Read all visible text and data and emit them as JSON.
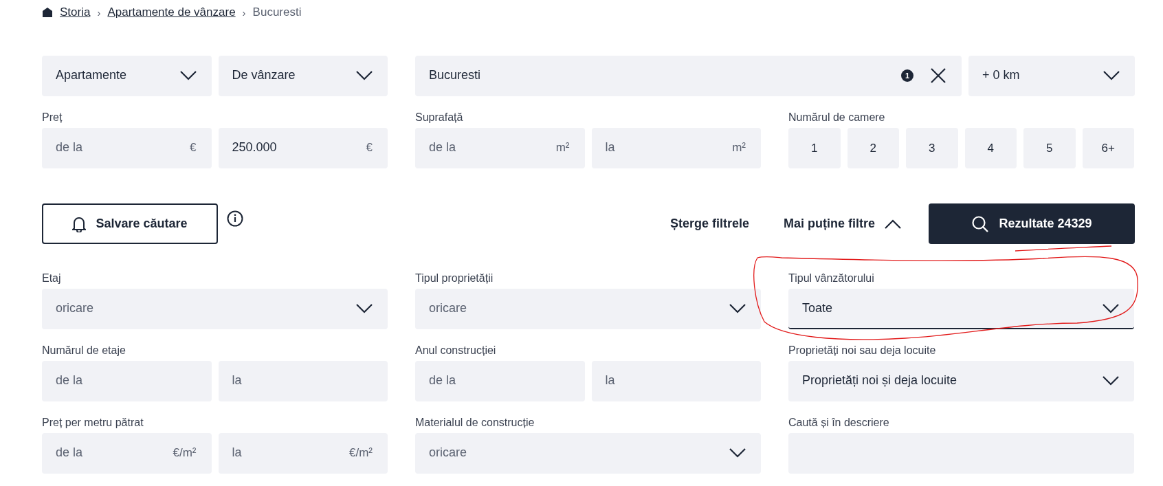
{
  "breadcrumb": [
    {
      "label": "Storia",
      "link": true
    },
    {
      "separator": "›",
      "label": "Apartamente de vânzare",
      "link": true
    },
    {
      "separator": "›",
      "label": "Bucuresti",
      "link": false
    }
  ],
  "search_bar": {
    "property_type": "Apartamente",
    "transaction": "De vânzare",
    "location": {
      "value": "Bucuresti",
      "badge": "1"
    },
    "radius": "+ 0 km"
  },
  "filters": [
    {
      "kind": "range",
      "label": "Preț",
      "inputs": [
        {
          "placeholder": "de la",
          "unit": "€"
        },
        {
          "value": "250.000",
          "unit": "€"
        }
      ]
    },
    {
      "kind": "range",
      "label": "Suprafață",
      "inputs": [
        {
          "placeholder": "de la",
          "unit": "m²"
        },
        {
          "placeholder": "la",
          "unit": "m²"
        }
      ]
    },
    {
      "kind": "rooms",
      "label": "Numărul de camere",
      "options": [
        {
          "label": "1",
          "selected": false
        },
        {
          "label": "2",
          "selected": false
        },
        {
          "label": "3",
          "selected": false
        },
        {
          "label": "4",
          "selected": false
        },
        {
          "label": "5",
          "selected": false
        },
        {
          "label": "6+",
          "selected": false
        }
      ]
    }
  ],
  "actions": {
    "save_search": "Salvare căutare",
    "clear": "Șterge filtrele",
    "toggle": "Mai puține filtre",
    "results": "Rezultate 24329"
  },
  "more_filters": [
    {
      "kind": "select",
      "label": "Etaj",
      "placeholder": "oricare",
      "focused": false
    },
    {
      "kind": "select",
      "label": "Tipul proprietății",
      "placeholder": "oricare",
      "focused": false
    },
    {
      "kind": "select",
      "label": "Tipul vânzătorului",
      "value": "Toate",
      "focused": true,
      "circled": true
    },
    {
      "kind": "range",
      "label": "Numărul de etaje",
      "inputs": [
        {
          "placeholder": "de la"
        },
        {
          "placeholder": "la"
        }
      ],
      "focused": false
    },
    {
      "kind": "range",
      "label": "Anul construcției",
      "inputs": [
        {
          "placeholder": "de la"
        },
        {
          "placeholder": "la"
        }
      ],
      "focused": false
    },
    {
      "kind": "select",
      "label": "Proprietăți noi sau deja locuite",
      "value": "Proprietăți noi și deja locuite",
      "focused": false
    },
    {
      "kind": "range",
      "label": "Preț per metru pătrat",
      "inputs": [
        {
          "placeholder": "de la",
          "unit": "€/m²"
        },
        {
          "placeholder": "la",
          "unit": "€/m²"
        }
      ],
      "focused": false
    },
    {
      "kind": "select",
      "label": "Materialul de construcție",
      "placeholder": "oricare",
      "focused": false
    },
    {
      "kind": "text",
      "label": "Caută și în descriere",
      "focused": false
    }
  ]
}
